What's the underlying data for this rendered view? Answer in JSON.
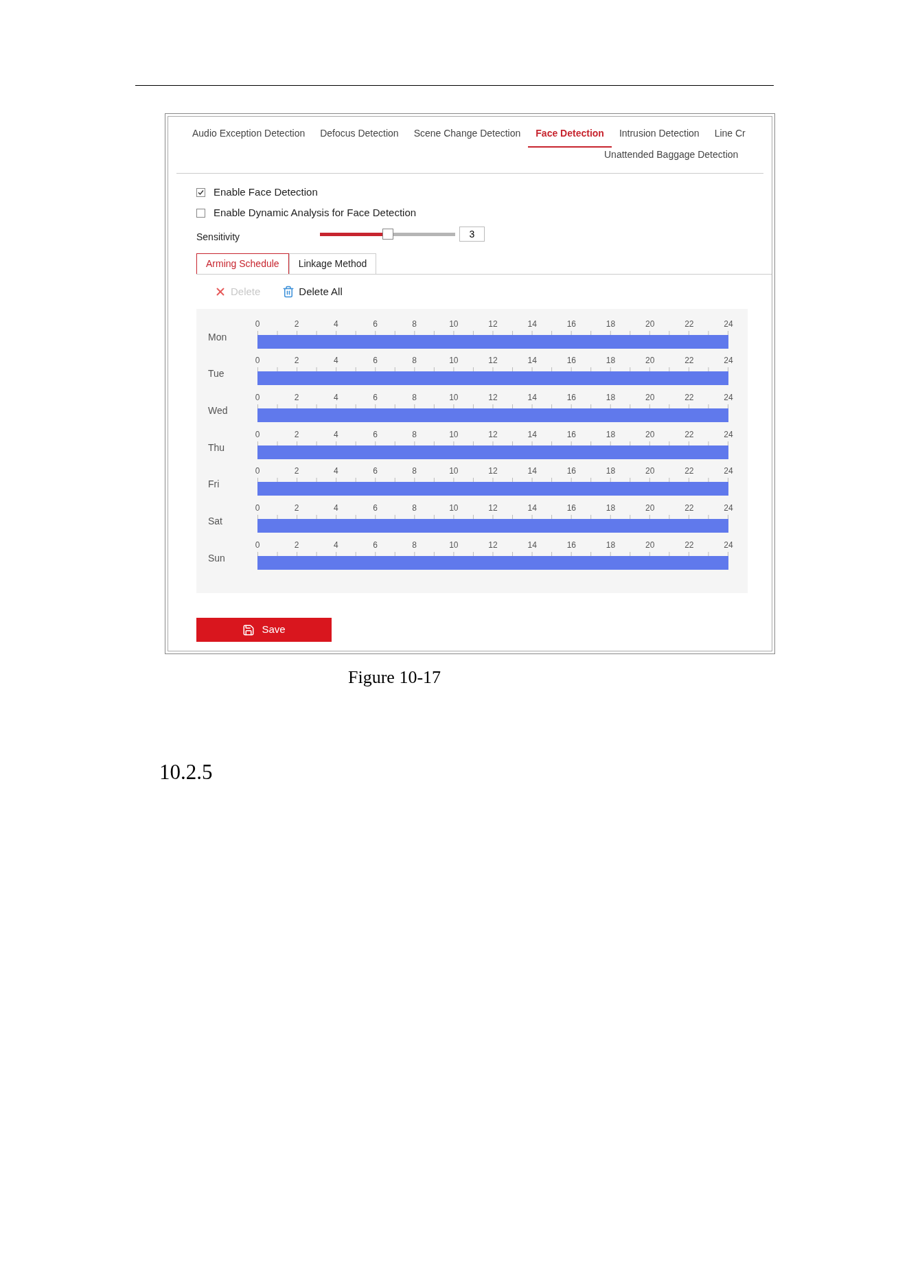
{
  "tabs": [
    {
      "label": "Audio Exception Detection",
      "selected": false
    },
    {
      "label": "Defocus Detection",
      "selected": false
    },
    {
      "label": "Scene Change Detection",
      "selected": false
    },
    {
      "label": "Face Detection",
      "selected": true
    },
    {
      "label": "Intrusion Detection",
      "selected": false
    },
    {
      "label": "Line Cr",
      "selected": false
    },
    {
      "label": "Unattended Baggage Detection",
      "selected": false
    }
  ],
  "options": [
    {
      "label": "Enable Face Detection",
      "checked": true
    },
    {
      "label": "Enable Dynamic Analysis for Face Detection",
      "checked": false
    }
  ],
  "sensitivity": {
    "label": "Sensitivity",
    "level": 0.5,
    "value": "3"
  },
  "subtabs": [
    {
      "label": "Arming Schedule",
      "selected": true
    },
    {
      "label": "Linkage Method",
      "selected": false
    }
  ],
  "actions": [
    {
      "label": "Delete",
      "disabled": true,
      "kind": "delete"
    },
    {
      "label": "Delete All",
      "disabled": false,
      "kind": "delete-all"
    }
  ],
  "schedule": [
    {
      "day": "Mon",
      "level": 1,
      "hours": [
        "0",
        "2",
        "4",
        "6",
        "8",
        "10",
        "12",
        "14",
        "16",
        "18",
        "20",
        "22",
        "24"
      ]
    },
    {
      "day": "Tue",
      "level": 1,
      "hours": [
        "0",
        "2",
        "4",
        "6",
        "8",
        "10",
        "12",
        "14",
        "16",
        "18",
        "20",
        "22",
        "24"
      ]
    },
    {
      "day": "Wed",
      "level": 1,
      "hours": [
        "0",
        "2",
        "4",
        "6",
        "8",
        "10",
        "12",
        "14",
        "16",
        "18",
        "20",
        "22",
        "24"
      ]
    },
    {
      "day": "Thu",
      "level": 1,
      "hours": [
        "0",
        "2",
        "4",
        "6",
        "8",
        "10",
        "12",
        "14",
        "16",
        "18",
        "20",
        "22",
        "24"
      ]
    },
    {
      "day": "Fri",
      "level": 1,
      "hours": [
        "0",
        "2",
        "4",
        "6",
        "8",
        "10",
        "12",
        "14",
        "16",
        "18",
        "20",
        "22",
        "24"
      ]
    },
    {
      "day": "Sat",
      "level": 1,
      "hours": [
        "0",
        "2",
        "4",
        "6",
        "8",
        "10",
        "12",
        "14",
        "16",
        "18",
        "20",
        "22",
        "24"
      ]
    },
    {
      "day": "Sun",
      "level": 1,
      "hours": [
        "0",
        "2",
        "4",
        "6",
        "8",
        "10",
        "12",
        "14",
        "16",
        "18",
        "20",
        "22",
        "24"
      ]
    }
  ],
  "save_button": "Save",
  "caption": "Figure 10-17",
  "section_heading": "10.2.5"
}
